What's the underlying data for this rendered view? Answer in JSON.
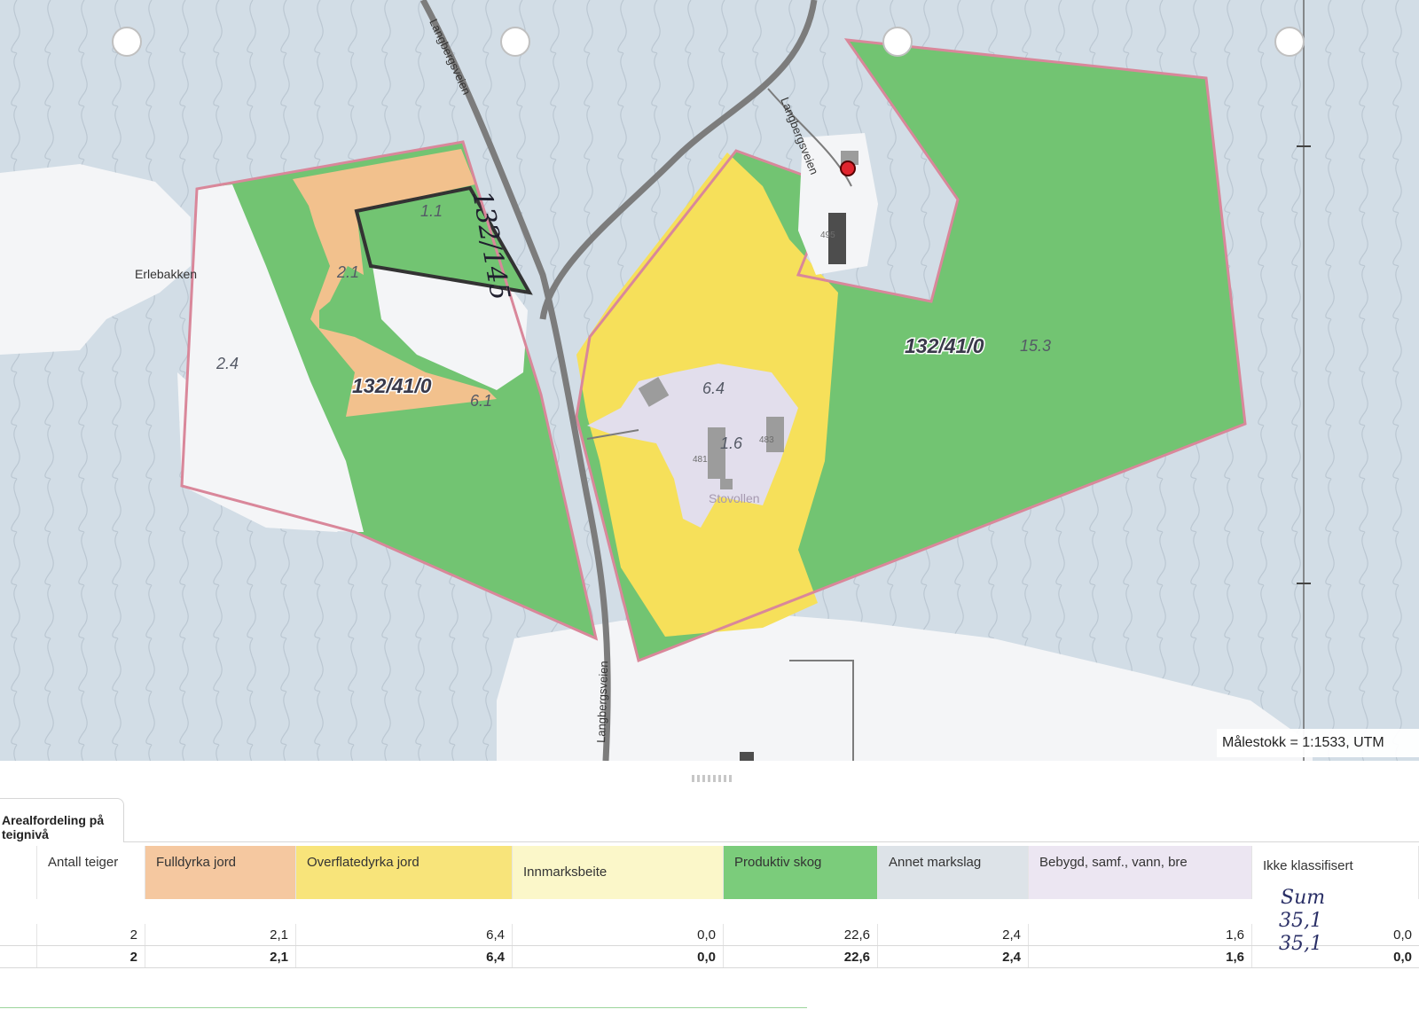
{
  "map": {
    "road_label": "Langbergsveien",
    "places": {
      "erlebakken": "Erlebakken",
      "stovollen": "Stovollen"
    },
    "parcel_id": "132/41/0",
    "handwritten_parcel": "132/145",
    "building_numbers": [
      "495",
      "481",
      "483"
    ],
    "area_labels": [
      "1.1",
      "2.1",
      "2.4",
      "6.1",
      "6.4",
      "1.6",
      "15.3"
    ],
    "scale_text": "Målestokk = 1:1533, UTM",
    "colors": {
      "background": "#d2dde6",
      "cleared_land": "#f4f5f7",
      "fulldyrka": "#f2c18d",
      "overflatedyrka": "#f6e05a",
      "produktiv_skog": "#72c472",
      "bebygd": "#e2deec",
      "boundary": "#d9879a",
      "road": "#7c7c7c"
    }
  },
  "table": {
    "tab_label": "Arealfordeling på teignivå",
    "headers": [
      {
        "label": "",
        "color": "#ffffff"
      },
      {
        "label": "Antall teiger",
        "color": "#ffffff"
      },
      {
        "label": "Fulldyrka jord",
        "color": "#f5c8a0"
      },
      {
        "label": "Overflatedyrka jord",
        "color": "#f8e47a"
      },
      {
        "label": "Innmarksbeite",
        "color": "#fbf7c9"
      },
      {
        "label": "Produktiv skog",
        "color": "#7bcc7b"
      },
      {
        "label": "Annet markslag",
        "color": "#dde3e8"
      },
      {
        "label": "Bebygd, samf., vann, bre",
        "color": "#ece6f2"
      },
      {
        "label": "Ikke klassifisert",
        "color": "#ffffff"
      }
    ],
    "rows": [
      {
        "cells": [
          "",
          "2",
          "2,1",
          "6,4",
          "0,0",
          "22,6",
          "2,4",
          "1,6",
          "0,0"
        ],
        "total": false
      },
      {
        "cells": [
          "",
          "2",
          "2,1",
          "6,4",
          "0,0",
          "22,6",
          "2,4",
          "1,6",
          "0,0"
        ],
        "total": true
      }
    ],
    "handwritten": {
      "sum_label": "Sum",
      "sum_row1": "35,1",
      "sum_row2": "35,1"
    }
  }
}
